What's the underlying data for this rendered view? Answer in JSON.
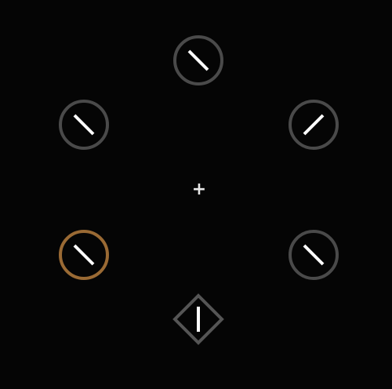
{
  "fixation": {
    "symbol": "+"
  },
  "colors": {
    "background": "#050505",
    "distractor_ring": "#4a4a4a",
    "highlight_ring": "#9a6a34",
    "target_diamond": "#555555",
    "line": "#ffffff",
    "fixation": "#e8e8e8"
  },
  "items": [
    {
      "id": "top",
      "shape": "circle",
      "line": "backslash",
      "highlight": false,
      "icon": "circle-with-line"
    },
    {
      "id": "upper-left",
      "shape": "circle",
      "line": "backslash",
      "highlight": false,
      "icon": "circle-with-line"
    },
    {
      "id": "upper-right",
      "shape": "circle",
      "line": "slash",
      "highlight": false,
      "icon": "circle-with-line"
    },
    {
      "id": "lower-left",
      "shape": "circle",
      "line": "backslash",
      "highlight": true,
      "icon": "circle-with-line"
    },
    {
      "id": "lower-right",
      "shape": "circle",
      "line": "backslash",
      "highlight": false,
      "icon": "circle-with-line"
    },
    {
      "id": "bottom",
      "shape": "diamond",
      "line": "vertical",
      "highlight": false,
      "icon": "diamond-with-line"
    }
  ]
}
